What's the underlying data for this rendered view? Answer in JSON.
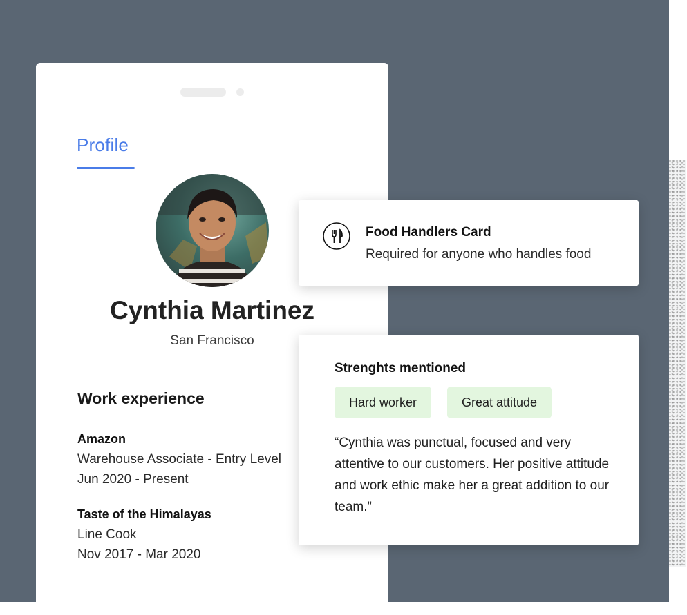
{
  "profile": {
    "tab_label": "Profile",
    "name": "Cynthia Martinez",
    "location": "San Francisco",
    "work_experience_title": "Work experience",
    "jobs": [
      {
        "company": "Amazon",
        "role": "Warehouse Associate - Entry Level",
        "dates": "Jun 2020 - Present"
      },
      {
        "company": "Taste of the Himalayas",
        "role": "Line Cook",
        "dates": "Nov 2017 - Mar 2020"
      }
    ]
  },
  "certification": {
    "icon": "fork-knife-icon",
    "title": "Food Handlers Card",
    "subtitle": "Required for anyone who handles food"
  },
  "strengths": {
    "title": "Strenghts mentioned",
    "chips": [
      "Hard worker",
      "Great attitude"
    ],
    "quote": "“Cynthia was punctual, focused and very attentive to our customers. Her positive attitude and work ethic make her a great addition to our team.”"
  },
  "colors": {
    "background": "#5a6673",
    "accent": "#4a7ce8",
    "chip_bg": "#e3f6df"
  }
}
